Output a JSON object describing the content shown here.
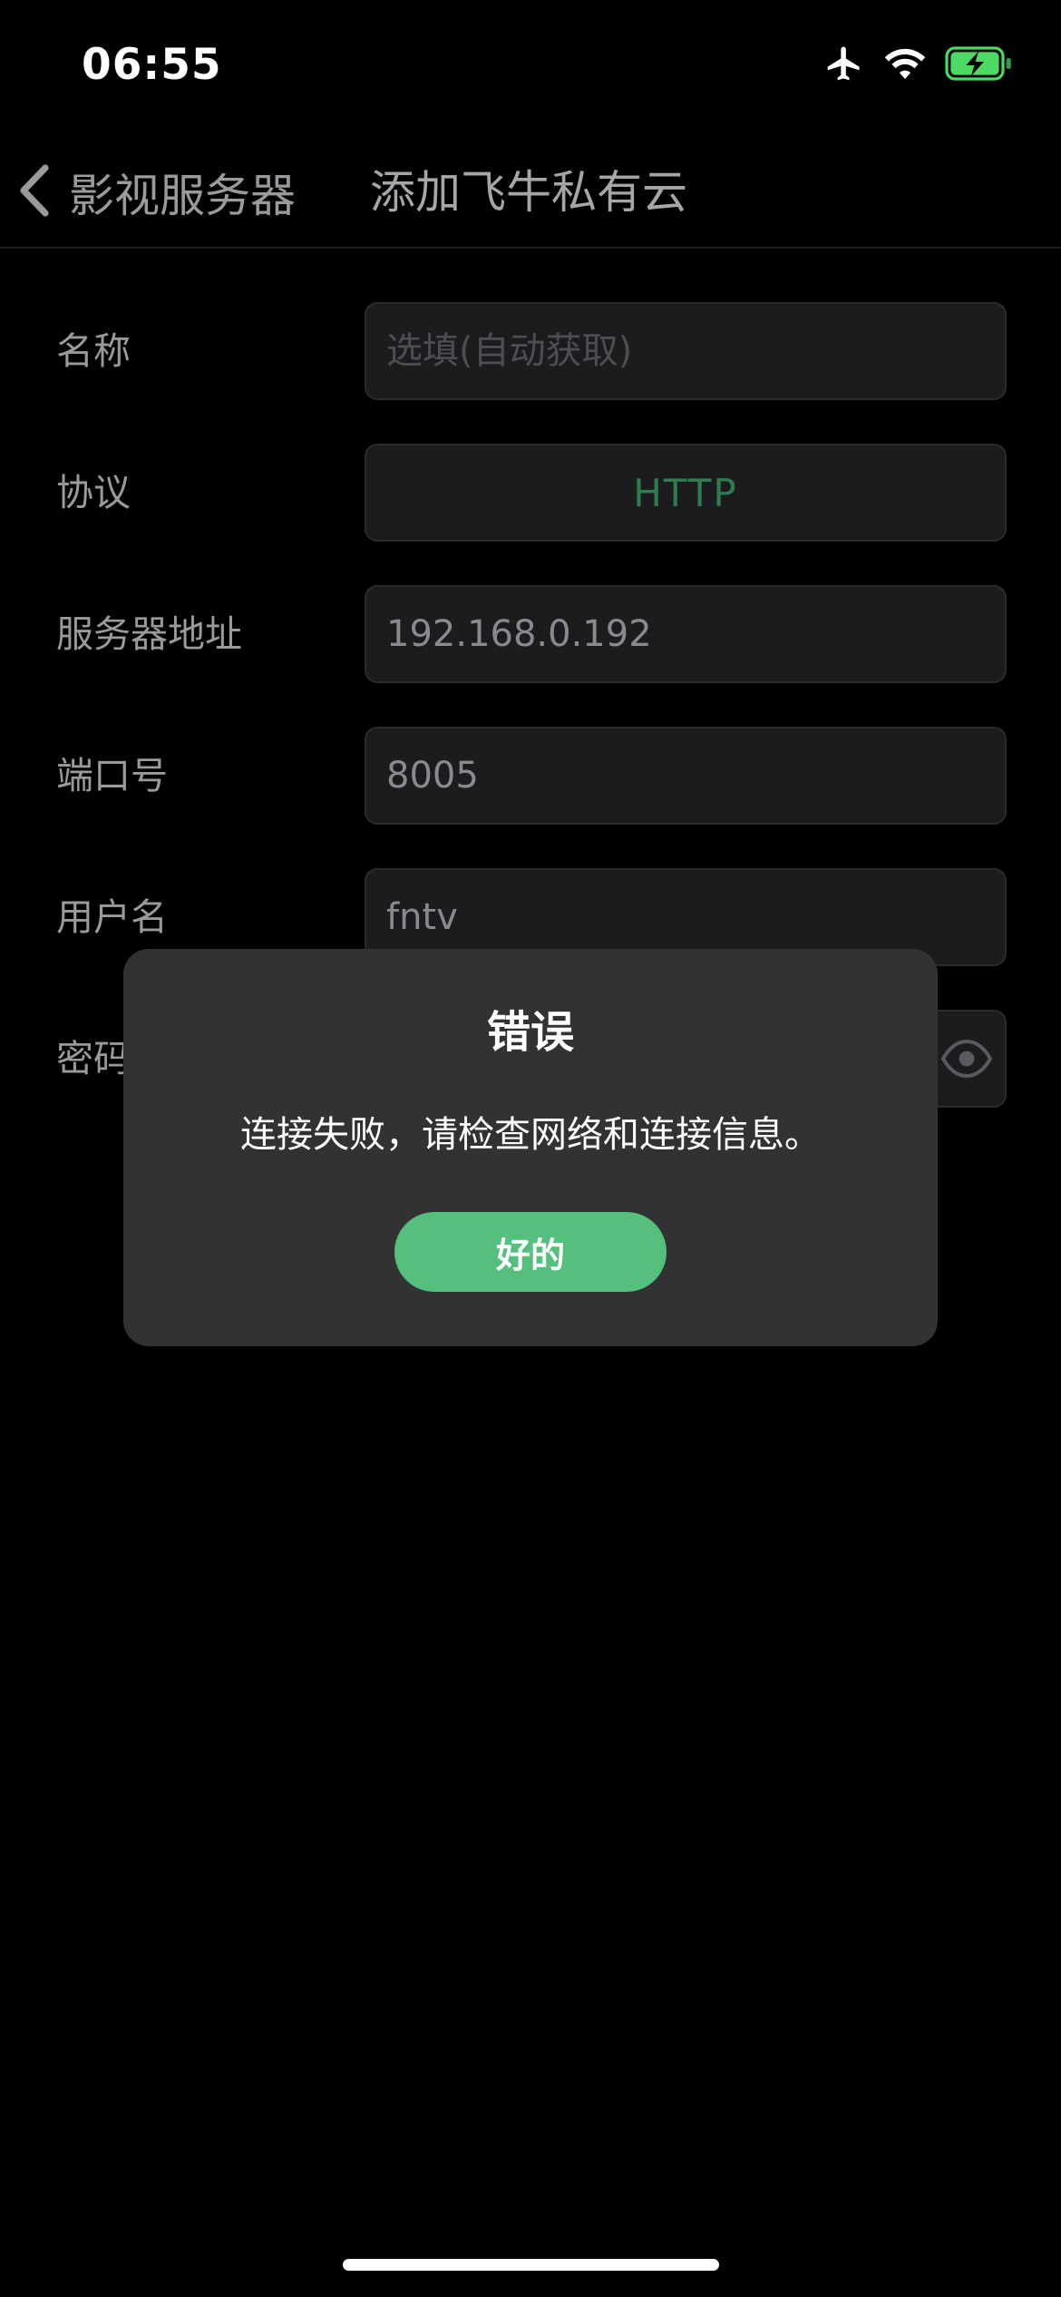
{
  "status_bar": {
    "time": "06:55",
    "icons": [
      "airplane-icon",
      "wifi-icon",
      "battery-charging-icon"
    ],
    "battery_color": "#4cd964"
  },
  "nav": {
    "back_label": "影视服务器",
    "title": "添加飞牛私有云"
  },
  "form": {
    "name": {
      "label": "名称",
      "value": "",
      "placeholder": "选填(自动获取)"
    },
    "protocol": {
      "label": "协议",
      "value": "HTTP"
    },
    "server_address": {
      "label": "服务器地址",
      "value": "192.168.0.192"
    },
    "port": {
      "label": "端口号",
      "value": "8005"
    },
    "username": {
      "label": "用户名",
      "value": "fntv"
    },
    "password": {
      "label": "密码",
      "value": ""
    }
  },
  "dialog": {
    "title": "错误",
    "message": "连接失败，请检查网络和连接信息。",
    "ok_label": "好的"
  },
  "colors": {
    "accent": "#55c07d",
    "protocol_text": "#2e7d4f",
    "background": "#000000",
    "field_background": "#1c1c1e",
    "dialog_background": "#323234"
  }
}
